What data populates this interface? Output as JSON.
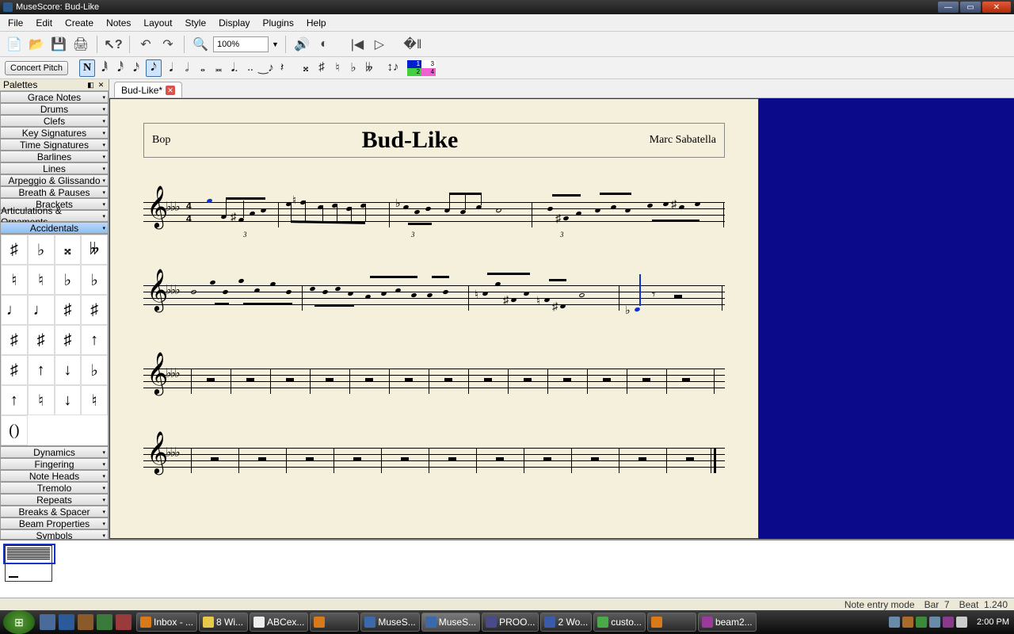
{
  "window": {
    "title": "MuseScore: Bud-Like"
  },
  "menu": [
    "File",
    "Edit",
    "Create",
    "Notes",
    "Layout",
    "Style",
    "Display",
    "Plugins",
    "Help"
  ],
  "toolbar": {
    "zoom": "100%"
  },
  "notebar": {
    "concert_pitch": "Concert Pitch",
    "n_label": "N",
    "voice_1": "1",
    "voice_2": "2",
    "voice_3": "3",
    "voice_4": "4"
  },
  "palettes": {
    "title": "Palettes",
    "sections": [
      "Grace Notes",
      "Drums",
      "Clefs",
      "Key Signatures",
      "Time Signatures",
      "Barlines",
      "Lines",
      "Arpeggio & Glissando",
      "Breath & Pauses",
      "Brackets",
      "Articulations & Ornaments",
      "Accidentals"
    ],
    "sections2": [
      "Dynamics",
      "Fingering",
      "Note Heads",
      "Tremolo",
      "Repeats",
      "Breaks & Spacer",
      "Beam Properties",
      "Symbols"
    ],
    "accidentals": [
      "♯",
      "♭",
      "𝄪",
      "𝄫",
      "♮",
      "♮",
      "♭",
      "♭",
      "♩",
      "♩",
      "♯",
      "♯",
      "♯",
      "♯",
      "♯",
      "↑",
      "♯",
      "↑",
      "↓",
      "♭",
      "↑",
      "♮",
      "↓",
      "♮",
      "()"
    ]
  },
  "tab": {
    "label": "Bud-Like*"
  },
  "score": {
    "tempo": "Bop",
    "title": "Bud-Like",
    "composer": "Marc Sabatella",
    "tuplet": "3",
    "timesig_top": "4",
    "timesig_bot": "4",
    "flats": "♭♭♭"
  },
  "status": {
    "mode": "Note entry mode",
    "bar": "Bar",
    "bar_n": "7",
    "beat": "Beat",
    "beat_n": "1.240"
  },
  "taskbar": {
    "items": [
      "Inbox - ...",
      "8 Wi...",
      "ABCex...",
      "",
      "MuseS...",
      "MuseS...",
      "PROO...",
      "2 Wo...",
      "custo...",
      "",
      "beam2..."
    ],
    "clock": "2:00 PM"
  }
}
